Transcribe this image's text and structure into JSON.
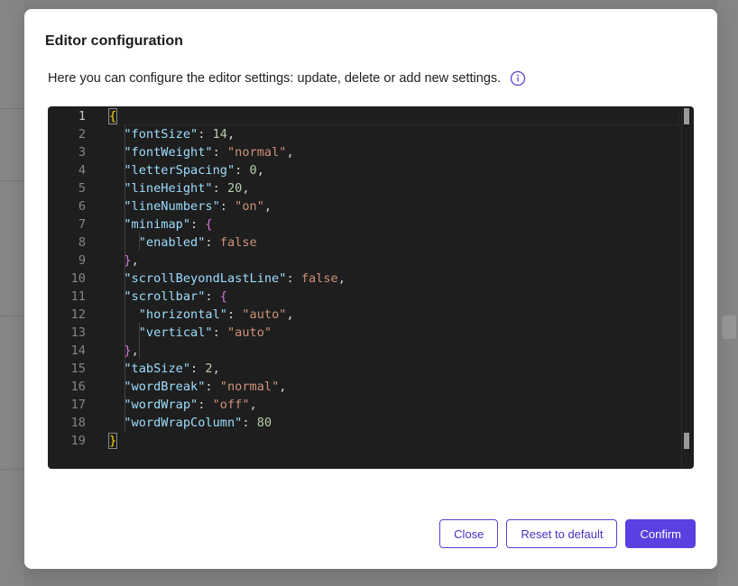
{
  "dialog": {
    "title": "Editor configuration",
    "description": "Here you can configure the editor settings: update, delete or add new settings.",
    "info_icon": "info-circle-icon",
    "accent_color": "#5b3fe0"
  },
  "editor": {
    "line_numbers": [
      "1",
      "2",
      "3",
      "4",
      "5",
      "6",
      "7",
      "8",
      "9",
      "10",
      "11",
      "12",
      "13",
      "14",
      "15",
      "16",
      "17",
      "18",
      "19"
    ],
    "lines": [
      "{",
      "  \"fontSize\": 14,",
      "  \"fontWeight\": \"normal\",",
      "  \"letterSpacing\": 0,",
      "  \"lineHeight\": 20,",
      "  \"lineNumbers\": \"on\",",
      "  \"minimap\": {",
      "    \"enabled\": false",
      "  },",
      "  \"scrollBeyondLastLine\": false,",
      "  \"scrollbar\": {",
      "    \"horizontal\": \"auto\",",
      "    \"vertical\": \"auto\"",
      "  },",
      "  \"tabSize\": 2,",
      "  \"wordBreak\": \"normal\",",
      "  \"wordWrap\": \"off\",",
      "  \"wordWrapColumn\": 80",
      "}"
    ],
    "active_line": 1,
    "colors": {
      "background": "#1e1e1e",
      "key": "#9cdcfe",
      "string": "#ce9178",
      "number": "#b5cea8",
      "bracket_outer": "#ffd700",
      "bracket_inner": "#da70d6"
    }
  },
  "buttons": {
    "close": "Close",
    "reset": "Reset to default",
    "confirm": "Confirm"
  }
}
